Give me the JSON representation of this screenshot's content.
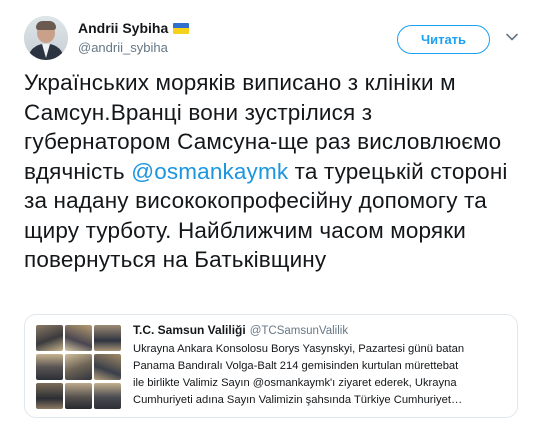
{
  "tweet": {
    "author": {
      "display_name": "Andrii Sybiha",
      "handle": "@andrii_sybiha",
      "flag_colors": {
        "top": "#2e6fd0",
        "bottom": "#f6d31a"
      }
    },
    "follow_button": "Читать",
    "text_parts": [
      "Українських моряків виписано з клініки м Самсун.Вранці вони зустрілися з губернатором Самсуна-ще раз висловлюємо вдячність ",
      "@osmankaymk",
      " та турецькій стороні за надану висококопрофесійну допомогу та щиру турботу. Найближчим часом моряки повернуться на Батьківщину"
    ]
  },
  "quoted_tweet": {
    "author_name": "T.C. Samsun Valiliği",
    "author_handle": "@TCSamsunValilik",
    "text_lines": [
      "Ukrayna Ankara Konsolosu Borys Yasynskyi, Pazartesi günü batan",
      "Panama Bandıralı Volga-Balt 214 gemisinden kurtulan mürettebat",
      "ile birlikte Valimiz Sayın @osmankaymk'ı ziyaret ederek, Ukrayna",
      "Cumhuriyeti adına Sayın Valimizin şahsında Türkiye Cumhuriyet…"
    ]
  },
  "colors": {
    "link": "#1b95e0",
    "accent": "#1da1f2",
    "secondary_text": "#657786",
    "border": "#e1e8ed"
  },
  "icons": {
    "more": "chevron-down-icon"
  }
}
